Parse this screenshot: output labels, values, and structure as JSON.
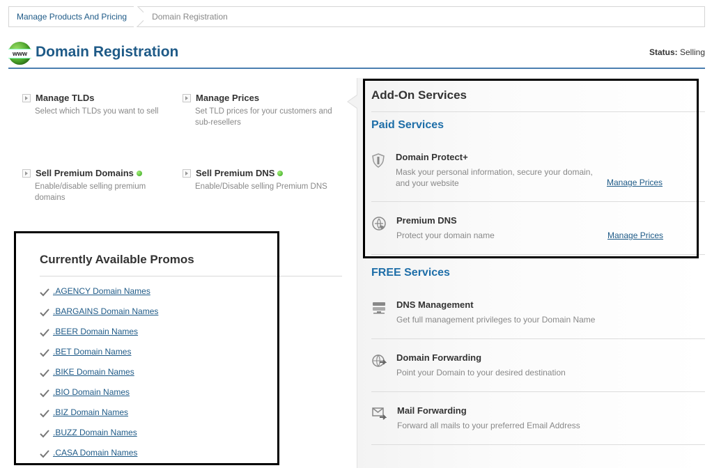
{
  "breadcrumb": {
    "link": "Manage Products And Pricing",
    "current": "Domain Registration"
  },
  "header": {
    "icon_text": "www",
    "title": "Domain Registration",
    "status_label": "Status:",
    "status_value": "Selling"
  },
  "features": [
    {
      "title": "Manage TLDs",
      "desc": "Select which TLDs you want to sell"
    },
    {
      "title": "Manage Prices",
      "desc": "Set TLD prices for your customers and sub-resellers"
    },
    {
      "title": "Sell Premium Domains",
      "desc": "Enable/disable selling premium domains"
    },
    {
      "title": "Sell Premium DNS",
      "desc": "Enable/Disable selling Premium DNS"
    }
  ],
  "promos": {
    "title": "Currently Available Promos",
    "items": [
      ".AGENCY Domain Names",
      ".BARGAINS Domain Names",
      ".BEER Domain Names",
      ".BET Domain Names",
      ".BIKE Domain Names",
      ".BIO Domain Names",
      ".BIZ Domain Names",
      ".BUZZ Domain Names",
      ".CASA Domain Names"
    ]
  },
  "addons": {
    "title": "Add-On Services",
    "paid_title": "Paid Services",
    "paid": [
      {
        "title": "Domain Protect+",
        "desc": "Mask your personal information, secure your domain, and your website",
        "link": "Manage Prices"
      },
      {
        "title": "Premium DNS",
        "desc": "Protect your domain name",
        "link": "Manage Prices"
      }
    ],
    "free_title": "FREE Services",
    "free": [
      {
        "title": "DNS Management",
        "desc": "Get full management privileges to your Domain Name"
      },
      {
        "title": "Domain Forwarding",
        "desc": "Point your Domain to your desired destination"
      },
      {
        "title": "Mail Forwarding",
        "desc": "Forward all mails to your preferred Email Address"
      }
    ]
  },
  "colors": {
    "title_blue": "#1e5a87",
    "subtitle_blue": "#1e6ea8",
    "status_green": "#2ea11a"
  }
}
